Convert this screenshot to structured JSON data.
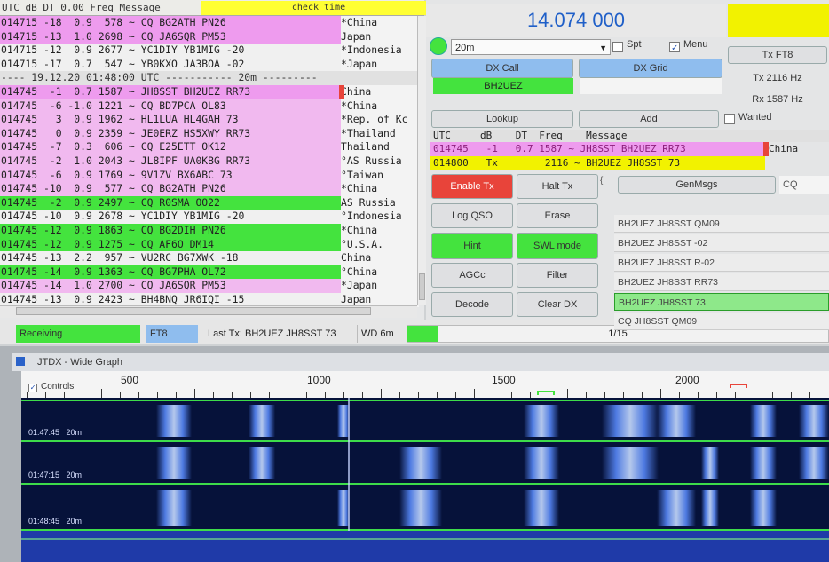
{
  "decode_list": {
    "header": {
      "cols": "UTC   dB    DT 0.00 Freq    Message",
      "check_label": "check time"
    },
    "rows": [
      {
        "text": "014715 -18  0.9  578 ~ CQ BG2ATH PN26",
        "country": "*China",
        "bg": "pink"
      },
      {
        "text": "014715 -13  1.0 2698 ~ CQ JA6SQR PM53",
        "country": "Japan",
        "bg": "pink"
      },
      {
        "text": "014715 -12  0.9 2677 ~ YC1DIY YB1MIG -20",
        "country": "*Indonesia",
        "bg": "white"
      },
      {
        "text": "014715 -17  0.7  547 ~ YB0KXO JA3BOA -02",
        "country": "*Japan",
        "bg": "white"
      },
      {
        "text": "---- 19.12.20 01:48:00 UTC ----------- 20m ---------",
        "country": "",
        "bg": "sep"
      },
      {
        "text": "014745  -1  0.7 1587 ~ JH8SST BH2UEZ RR73",
        "country": "China",
        "bg": "pink"
      },
      {
        "text": "014745  -6 -1.0 1221 ~ CQ BD7PCA OL83",
        "country": "*China",
        "bg": "lpink"
      },
      {
        "text": "014745   3  0.9 1962 ~ HL1LUA HL4GAH 73",
        "country": "*Rep. of Kc",
        "bg": "lpink"
      },
      {
        "text": "014745   0  0.9 2359 ~ JE0ERZ HS5XWY RR73",
        "country": "*Thailand",
        "bg": "lpink"
      },
      {
        "text": "014745  -7  0.3  606 ~ CQ E25ETT OK12",
        "country": "Thailand",
        "bg": "lpink"
      },
      {
        "text": "014745  -2  1.0 2043 ~ JL8IPF UA0KBG RR73",
        "country": "°AS Russia",
        "bg": "lpink"
      },
      {
        "text": "014745  -6  0.9 1769 ~ 9V1ZV BX6ABC 73",
        "country": "°Taiwan",
        "bg": "lpink"
      },
      {
        "text": "014745 -10  0.9  577 ~ CQ BG2ATH PN26",
        "country": "*China",
        "bg": "lpink"
      },
      {
        "text": "014745  -2  0.9 2497 ~ CQ R0SMA OO22",
        "country": "AS Russia",
        "bg": "green"
      },
      {
        "text": "014745 -10  0.9 2678 ~ YC1DIY YB1MIG -20",
        "country": "°Indonesia",
        "bg": "white"
      },
      {
        "text": "014745 -12  0.9 1863 ~ CQ BG2DIH PN26",
        "country": "*China",
        "bg": "green"
      },
      {
        "text": "014745 -12  0.9 1275 ~ CQ AF6O DM14",
        "country": "°U.S.A.",
        "bg": "green"
      },
      {
        "text": "014745 -13  2.2  957 ~ VU2RC BG7XWK -18",
        "country": "China",
        "bg": "white"
      },
      {
        "text": "014745 -14  0.9 1363 ~ CQ BG7PHA OL72",
        "country": "°China",
        "bg": "green"
      },
      {
        "text": "014745 -14  1.0 2700 ~ CQ JA6SQR PM53",
        "country": "*Japan",
        "bg": "lpink"
      },
      {
        "text": "014745 -13  0.9 2423 ~ BH4BNQ JR6IQI -15",
        "country": "Japan",
        "bg": "white"
      }
    ]
  },
  "status": {
    "mode_state": "Receiving",
    "mode": "FT8",
    "last_tx": "Last Tx: BH2UEZ JH8SST 73",
    "wd": "WD 6m",
    "page": "1/15"
  },
  "freq": {
    "display": "14.074 000",
    "band": "20m",
    "spt_label": "Spt",
    "menu_label": "Menu",
    "tx_mode": "Tx FT8",
    "tx_hz": "Tx  2116  Hz",
    "rx_hz": "Rx  1587  Hz"
  },
  "dx": {
    "call_label": "DX Call",
    "grid_label": "DX Grid",
    "call_value": "BH2UEZ",
    "grid_value": "",
    "lookup": "Lookup",
    "add": "Add",
    "wanted": "Wanted"
  },
  "qso": {
    "header": "UTC     dB    DT  Freq    Message",
    "rows": [
      {
        "text": "014745   -1   0.7 1587 ~ JH8SST BH2UEZ RR73",
        "country": "China",
        "bg": "pink"
      },
      {
        "text": "014800   Tx        2116 ~ BH2UEZ JH8SST 73",
        "country": "",
        "bg": "yellow"
      }
    ]
  },
  "buttons": {
    "enable_tx": "Enable Tx",
    "halt_tx": "Halt Tx",
    "log_qso": "Log QSO",
    "erase": "Erase",
    "hint": "Hint",
    "swl": "SWL mode",
    "agcc": "AGCc",
    "filter": "Filter",
    "decode": "Decode",
    "clear_dx": "Clear DX",
    "genmsgs": "GenMsgs",
    "cq": "CQ"
  },
  "tx_messages": [
    "BH2UEZ JH8SST QM09",
    "BH2UEZ JH8SST -02",
    "BH2UEZ JH8SST R-02",
    "BH2UEZ JH8SST RR73",
    "BH2UEZ JH8SST 73",
    "CQ JH8SST QM09"
  ],
  "wide_graph": {
    "title": "JTDX - Wide Graph",
    "controls": "Controls",
    "ticks": [
      "500",
      "1000",
      "1500",
      "2000"
    ],
    "band_labels": [
      {
        "time": "01:47:45",
        "band": "20m"
      },
      {
        "time": "01:47:15",
        "band": "20m"
      },
      {
        "time": "01:48:45",
        "band": "20m"
      }
    ]
  },
  "colors": {
    "pink": "#ee9bee",
    "light_pink": "#f1b9ef",
    "green": "#44e33e",
    "yellow": "#f2f200",
    "red": "#e8443a",
    "blue_btn": "#8fbdee",
    "freq_blue": "#1f5fc8"
  }
}
